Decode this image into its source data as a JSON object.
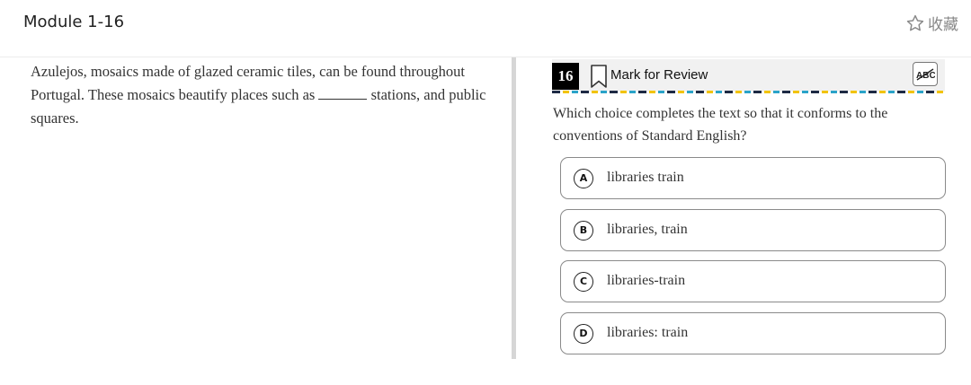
{
  "header": {
    "module_title": "Module 1-16",
    "collect_label": "收藏",
    "collect_icon": "star-outline-icon"
  },
  "passage": {
    "text_before": "Azulejos, mosaics made of glazed ceramic tiles, can be found throughout Portugal. These mosaics beautify places such as ",
    "text_after": " stations, and public squares."
  },
  "question": {
    "number": "16",
    "mark_label": "Mark for Review",
    "bookmark_icon": "bookmark-icon",
    "eliminator_icon": "abc-strikethrough-icon",
    "prompt": "Which choice completes the text so that it conforms to the conventions of Standard English?",
    "choices": [
      {
        "letter": "A",
        "text": "libraries train"
      },
      {
        "letter": "B",
        "text": "libraries, train"
      },
      {
        "letter": "C",
        "text": "libraries-train"
      },
      {
        "letter": "D",
        "text": "libraries: train"
      }
    ]
  },
  "colors": {
    "accent_dark": "#1e2a44",
    "accent_yellow": "#f2c300",
    "accent_blue": "#2aa3c9"
  }
}
